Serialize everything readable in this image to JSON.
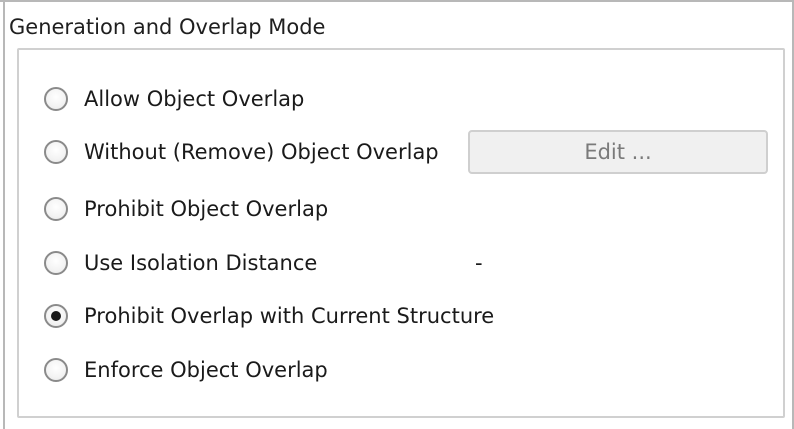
{
  "group": {
    "title": "Generation and Overlap Mode"
  },
  "options": [
    {
      "label": "Allow Object Overlap",
      "selected": false
    },
    {
      "label": "Without (Remove) Object Overlap",
      "selected": false
    },
    {
      "label": "Prohibit Object Overlap",
      "selected": false
    },
    {
      "label": "Use Isolation Distance",
      "selected": false
    },
    {
      "label": "Prohibit Overlap with Current Structure",
      "selected": true
    },
    {
      "label": "Enforce Object Overlap",
      "selected": false
    }
  ],
  "edit_button": {
    "label": "Edit ...",
    "enabled": false
  },
  "isolation_distance": {
    "value": "-"
  }
}
